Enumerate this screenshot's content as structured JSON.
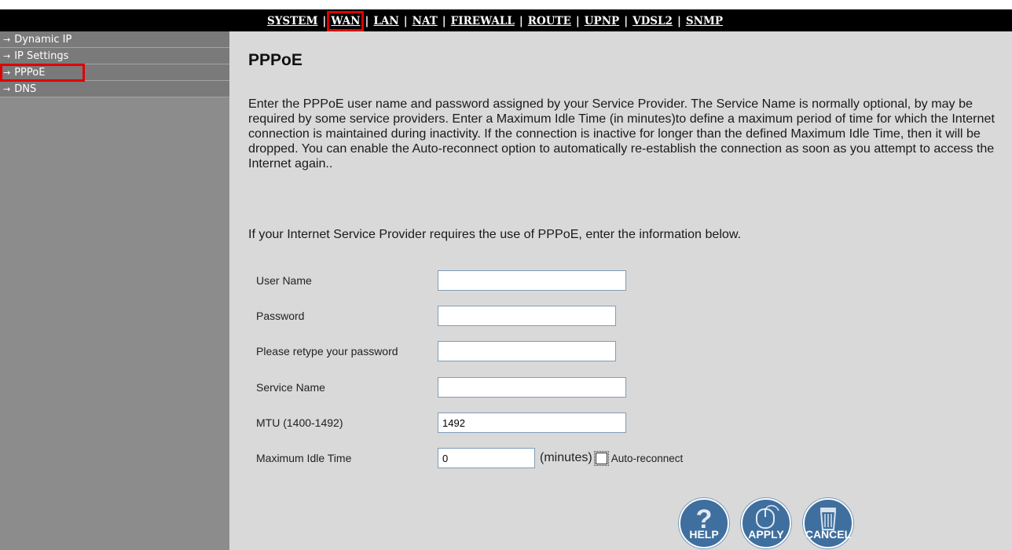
{
  "topnav": {
    "items": [
      "SYSTEM",
      "WAN",
      "LAN",
      "NAT",
      "FIREWALL",
      "ROUTE",
      "UPNP",
      "VDSL2",
      "SNMP"
    ],
    "separator": "|",
    "active": "WAN"
  },
  "sidebar": {
    "arrow": "→",
    "items": [
      {
        "label": "Dynamic IP"
      },
      {
        "label": "IP Settings"
      },
      {
        "label": "PPPoE"
      },
      {
        "label": "DNS"
      }
    ],
    "selected": "PPPoE"
  },
  "main": {
    "title": "PPPoE",
    "intro": "Enter the PPPoE user name and password assigned by your Service Provider. The Service Name is normally optional, by may be required by some service providers. Enter a Maximum Idle Time (in minutes)to define a maximum period of time for which the Internet connection is maintained during inactivity. If the connection is inactive for longer than the defined Maximum Idle Time, then it will be dropped. You can enable the Auto-reconnect option to automatically re-establish the connection as soon as you attempt to access the Internet again..",
    "note": "If your Internet Service Provider requires the use of PPPoE, enter the information below."
  },
  "form": {
    "user_name": {
      "label": "User Name",
      "value": ""
    },
    "password": {
      "label": "Password",
      "value": ""
    },
    "retype_password": {
      "label": "Please retype your password",
      "value": ""
    },
    "service_name": {
      "label": "Service Name",
      "value": ""
    },
    "mtu": {
      "label": "MTU (1400-1492)",
      "value": "1492"
    },
    "max_idle": {
      "label": "Maximum Idle Time",
      "value": "0",
      "unit": "(minutes)"
    },
    "auto_reconnect": {
      "label": "Auto-reconnect",
      "checked": false
    }
  },
  "buttons": {
    "help": {
      "label": "HELP",
      "icon": "question-mark-icon"
    },
    "apply": {
      "label": "APPLY",
      "icon": "mouse-icon"
    },
    "cancel": {
      "label": "CANCEL",
      "icon": "trash-can-icon"
    }
  },
  "colors": {
    "highlight": "#e00000",
    "button": "#3f6f9e",
    "sidebar": "#8c8c8c",
    "background": "#d9d9d9"
  }
}
